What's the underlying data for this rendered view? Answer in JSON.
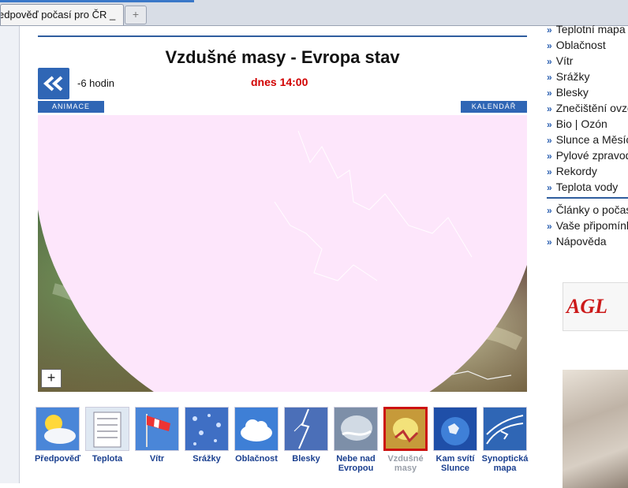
{
  "browser": {
    "tab_title": "edpověď počasí pro ČR _",
    "new_tab_symbol": "+"
  },
  "header": {
    "title": "Vzdušné masy - Evropa stav",
    "prev_label": "-6 hodin",
    "current_label": "dnes 14:00",
    "animation_label": "ANIMACE",
    "calendar_label": "KALENDÁŘ"
  },
  "map": {
    "zoom_label": "+"
  },
  "thumbnails": [
    {
      "label1": "Předpověď",
      "label2": "",
      "icon": "sun-cloud-icon"
    },
    {
      "label1": "Teplota",
      "label2": "",
      "icon": "thermometer-icon"
    },
    {
      "label1": "Vítr",
      "label2": "",
      "icon": "windsock-icon"
    },
    {
      "label1": "Srážky",
      "label2": "",
      "icon": "raindrops-icon"
    },
    {
      "label1": "Oblačnost",
      "label2": "",
      "icon": "cloud-icon"
    },
    {
      "label1": "Blesky",
      "label2": "",
      "icon": "lightning-icon"
    },
    {
      "label1": "Nebe nad",
      "label2": "Evropou",
      "icon": "satellite-europe-icon"
    },
    {
      "label1": "Vzdušné",
      "label2": "masy",
      "icon": "air-mass-icon"
    },
    {
      "label1": "Kam svítí",
      "label2": "Slunce",
      "icon": "earth-sun-icon"
    },
    {
      "label1": "Synoptická",
      "label2": "mapa",
      "icon": "synoptic-map-icon"
    }
  ],
  "menu": {
    "group1": [
      "Teplotní mapa",
      "Oblačnost",
      "Vítr",
      "Srážky",
      "Blesky",
      "Znečištění ovzduší",
      "Bio | Ozón",
      "Slunce a Měsíc",
      "Pylové zpravodajství",
      "Rekordy",
      "Teplota vody"
    ],
    "group2": [
      "Články o počasí",
      "Vaše připomínky",
      "Nápověda"
    ],
    "bullet": "»"
  },
  "ads": {
    "logo_text": "AGL"
  },
  "colors": {
    "accent_blue": "#2f66b5",
    "current_time_red": "#d10000",
    "active_border": "#cc1111"
  }
}
